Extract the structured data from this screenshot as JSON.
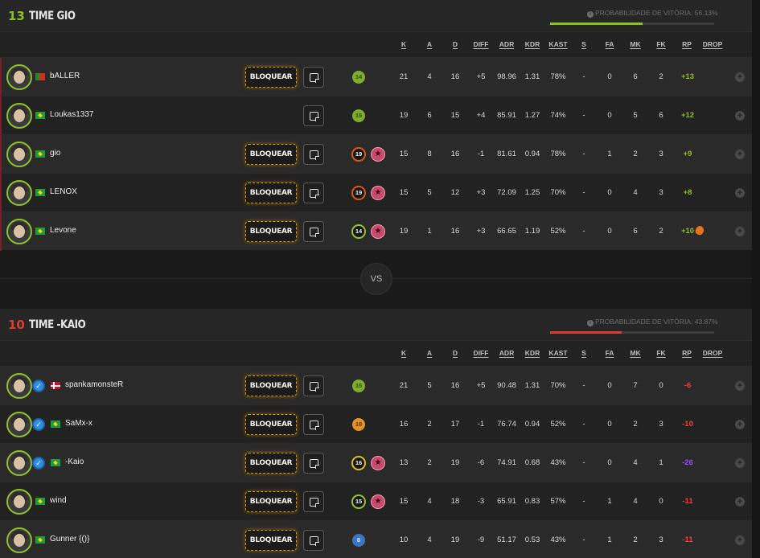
{
  "columns": [
    "K",
    "A",
    "D",
    "DIFF",
    "ADR",
    "KDR",
    "KAST",
    "S",
    "FA",
    "MK",
    "FK",
    "RP",
    "DROP"
  ],
  "block_label": "BLOQUEAR",
  "vs_label": "VS",
  "teams": [
    {
      "score": "13",
      "score_color": "#8cc21f",
      "name": "TIME GIO",
      "win_prob_label": "PROBABILIDADE DE VITÓRIA: 56.13%",
      "win_prob_value": 0.5613,
      "bar_color": "#8cc21f",
      "players": [
        {
          "name": "bALLER",
          "flag": "portugal-flag",
          "verified": false,
          "block": true,
          "level": "14",
          "level_style": "green-circle",
          "star": false,
          "k": "21",
          "a": "4",
          "d": "16",
          "diff": "+5",
          "adr": "98.96",
          "kdr": "1.31",
          "kast": "78%",
          "s": "-",
          "fa": "0",
          "mk": "6",
          "fk": "2",
          "rp": "+13",
          "rp_class": "pos",
          "fire": false
        },
        {
          "name": "Loukas1337",
          "flag": "brazil-flag",
          "verified": false,
          "block": false,
          "level": "15",
          "level_style": "green-circle",
          "star": false,
          "k": "19",
          "a": "6",
          "d": "15",
          "diff": "+4",
          "adr": "85.91",
          "kdr": "1.27",
          "kast": "74%",
          "s": "-",
          "fa": "0",
          "mk": "5",
          "fk": "6",
          "rp": "+12",
          "rp_class": "pos",
          "fire": false
        },
        {
          "name": "gio",
          "flag": "brazil-flag",
          "verified": false,
          "block": true,
          "level": "19",
          "level_style": "hex-orange",
          "star": true,
          "k": "15",
          "a": "8",
          "d": "16",
          "diff": "-1",
          "adr": "81.61",
          "kdr": "0.94",
          "kast": "78%",
          "s": "-",
          "fa": "1",
          "mk": "2",
          "fk": "3",
          "rp": "+9",
          "rp_class": "pos",
          "fire": false
        },
        {
          "name": "LENOX",
          "flag": "brazil-flag",
          "verified": false,
          "block": true,
          "level": "19",
          "level_style": "hex-orange",
          "star": true,
          "k": "15",
          "a": "5",
          "d": "12",
          "diff": "+3",
          "adr": "72.09",
          "kdr": "1.25",
          "kast": "70%",
          "s": "-",
          "fa": "0",
          "mk": "4",
          "fk": "3",
          "rp": "+8",
          "rp_class": "pos",
          "fire": false
        },
        {
          "name": "Levone",
          "flag": "brazil-flag",
          "verified": false,
          "block": true,
          "level": "14",
          "level_style": "hex-green",
          "star": true,
          "k": "19",
          "a": "1",
          "d": "16",
          "diff": "+3",
          "adr": "66.65",
          "kdr": "1.19",
          "kast": "52%",
          "s": "-",
          "fa": "0",
          "mk": "6",
          "fk": "2",
          "rp": "+10",
          "rp_class": "pos",
          "fire": true
        }
      ]
    },
    {
      "score": "10",
      "score_color": "#e03a2e",
      "name": "TIME -KAIO",
      "win_prob_label": "PROBABILIDADE DE VITÓRIA: 43.87%",
      "win_prob_value": 0.4387,
      "bar_color": "#e03a2e",
      "players": [
        {
          "name": "spankamonsteR",
          "flag": "denmark-flag",
          "verified": true,
          "block": true,
          "level": "15",
          "level_style": "green-circle",
          "star": false,
          "k": "21",
          "a": "5",
          "d": "16",
          "diff": "+5",
          "adr": "90.48",
          "kdr": "1.31",
          "kast": "70%",
          "s": "-",
          "fa": "0",
          "mk": "7",
          "fk": "0",
          "rp": "-6",
          "rp_class": "neg",
          "fire": false
        },
        {
          "name": "SaMx-x",
          "flag": "brazil-flag",
          "verified": true,
          "block": true,
          "level": "18",
          "level_style": "orange-circle",
          "star": false,
          "k": "16",
          "a": "2",
          "d": "17",
          "diff": "-1",
          "adr": "76.74",
          "kdr": "0.94",
          "kast": "52%",
          "s": "-",
          "fa": "0",
          "mk": "2",
          "fk": "3",
          "rp": "-10",
          "rp_class": "neg",
          "fire": false
        },
        {
          "name": "-Kaio",
          "flag": "brazil-flag",
          "verified": true,
          "block": true,
          "level": "16",
          "level_style": "hex-yellow",
          "star": true,
          "k": "13",
          "a": "2",
          "d": "19",
          "diff": "-6",
          "adr": "74.91",
          "kdr": "0.68",
          "kast": "43%",
          "s": "-",
          "fa": "0",
          "mk": "4",
          "fk": "1",
          "rp": "-26",
          "rp_class": "purple",
          "fire": false
        },
        {
          "name": "wind",
          "flag": "brazil-flag",
          "verified": false,
          "block": true,
          "level": "15",
          "level_style": "hex-green",
          "star": true,
          "k": "15",
          "a": "4",
          "d": "18",
          "diff": "-3",
          "adr": "65.91",
          "kdr": "0.83",
          "kast": "57%",
          "s": "-",
          "fa": "1",
          "mk": "4",
          "fk": "0",
          "rp": "-11",
          "rp_class": "neg",
          "fire": false
        },
        {
          "name": "Gunner {()}",
          "flag": "brazil-flag",
          "verified": false,
          "block": true,
          "level": "8",
          "level_style": "blue-circle",
          "star": false,
          "k": "10",
          "a": "4",
          "d": "19",
          "diff": "-9",
          "adr": "51.17",
          "kdr": "0.53",
          "kast": "43%",
          "s": "-",
          "fa": "1",
          "mk": "2",
          "fk": "3",
          "rp": "-11",
          "rp_class": "neg",
          "fire": false
        }
      ]
    }
  ]
}
